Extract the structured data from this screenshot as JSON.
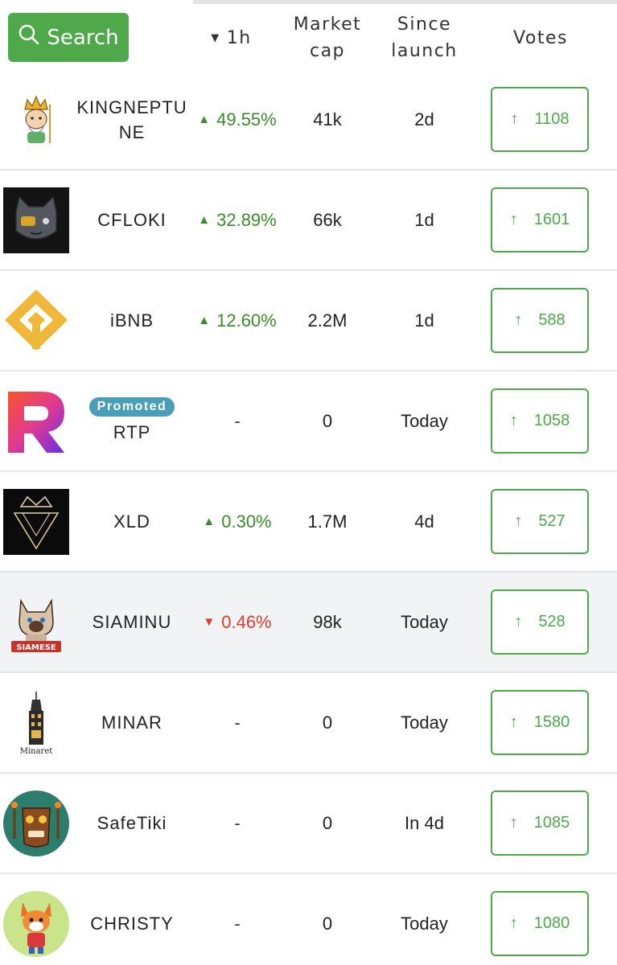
{
  "header": {
    "search_label": "Search",
    "col_1h": "1h",
    "col_market_line1": "Market",
    "col_market_line2": "cap",
    "col_since_line1": "Since",
    "col_since_line2": "launch",
    "col_votes": "Votes"
  },
  "colors": {
    "brand_green": "#4fa84a",
    "change_up": "#3a8c2a",
    "change_down": "#e03b2c",
    "promoted_badge": "#4a9fb7"
  },
  "rows": [
    {
      "logo": "king-neptune-icon",
      "promoted": "",
      "name": "KINGNEPTUNE",
      "change": "49.55%",
      "direction": "up",
      "market_cap": "41k",
      "since": "2d",
      "votes": "1108"
    },
    {
      "logo": "cfloki-cat-icon",
      "promoted": "",
      "name": "CFLOKI",
      "change": "32.89%",
      "direction": "up",
      "market_cap": "66k",
      "since": "1d",
      "votes": "1601"
    },
    {
      "logo": "ibnb-diamond-icon",
      "promoted": "",
      "name": "iBNB",
      "change": "12.60%",
      "direction": "up",
      "market_cap": "2.2M",
      "since": "1d",
      "votes": "588"
    },
    {
      "logo": "rtp-r-icon",
      "promoted": "Promoted",
      "name": "RTP",
      "change": "-",
      "direction": "none",
      "market_cap": "0",
      "since": "Today",
      "votes": "1058"
    },
    {
      "logo": "xld-crown-icon",
      "promoted": "",
      "name": "XLD",
      "change": "0.30%",
      "direction": "up",
      "market_cap": "1.7M",
      "since": "4d",
      "votes": "527"
    },
    {
      "logo": "siamese-cat-icon",
      "promoted": "",
      "name": "SIAMINU",
      "change": "0.46%",
      "direction": "down",
      "market_cap": "98k",
      "since": "Today",
      "votes": "528"
    },
    {
      "logo": "minaret-tower-icon",
      "promoted": "",
      "name": "MINAR",
      "change": "-",
      "direction": "none",
      "market_cap": "0",
      "since": "Today",
      "votes": "1580"
    },
    {
      "logo": "safetiki-mask-icon",
      "promoted": "",
      "name": "SafeTiki",
      "change": "-",
      "direction": "none",
      "market_cap": "0",
      "since": "In 4d",
      "votes": "1085"
    },
    {
      "logo": "christy-fox-icon",
      "promoted": "",
      "name": "CHRISTY",
      "change": "-",
      "direction": "none",
      "market_cap": "0",
      "since": "Today",
      "votes": "1080"
    }
  ],
  "logo_texts": {
    "siamese": "SIAMESE",
    "minaret": "Minaret"
  }
}
